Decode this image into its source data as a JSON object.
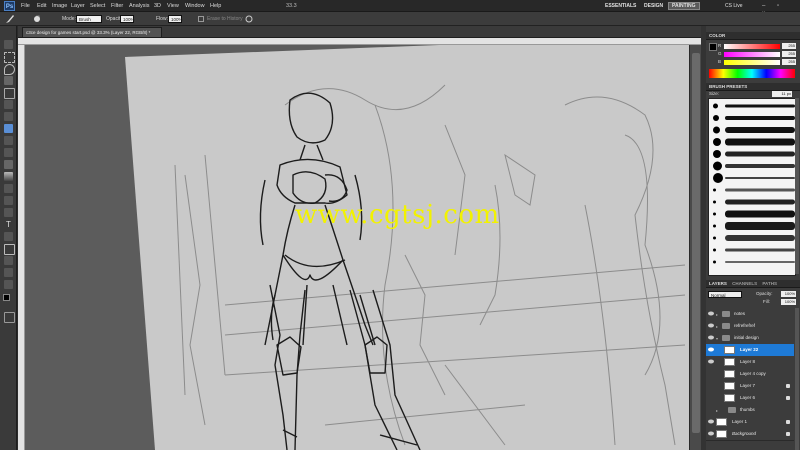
{
  "app": {
    "logo": "Ps"
  },
  "menu": [
    "File",
    "Edit",
    "Image",
    "Layer",
    "Select",
    "Filter",
    "Analysis",
    "3D",
    "View",
    "Window",
    "Help"
  ],
  "menu_right": {
    "zoom": "33.3",
    "workspaces": [
      "ESSENTIALS",
      "DESIGN",
      "PAINTING"
    ],
    "active_workspace": "PAINTING",
    "cslive": "CS Live"
  },
  "options": {
    "mode_label": "Mode:",
    "mode_value": "Brush",
    "opacity_label": "Opacity:",
    "opacity_value": "100%",
    "flow_label": "Flow:",
    "flow_value": "100%",
    "erase_history": "Erase to History",
    "brush_size": "11"
  },
  "document": {
    "tab": "c3ce design for games start.psd @ 33.3% (Layer 22, RGB/8) *"
  },
  "watermark": "www.cgtsj.com",
  "color_panel": {
    "title": "COLOR",
    "channels": [
      {
        "label": "R",
        "value": "255"
      },
      {
        "label": "G",
        "value": "255"
      },
      {
        "label": "B",
        "value": "255"
      }
    ]
  },
  "brush_panel": {
    "title": "BRUSH PRESETS",
    "size_label": "Size:",
    "size_value": "11 px"
  },
  "layers_panel": {
    "tabs": [
      "LAYERS",
      "CHANNELS",
      "PATHS"
    ],
    "blend_mode": "Normal",
    "opacity_label": "Opacity:",
    "opacity_value": "100%",
    "fill_label": "Fill:",
    "fill_value": "100%",
    "layers": [
      {
        "name": "notes",
        "type": "group"
      },
      {
        "name": "refrefrefref",
        "type": "group"
      },
      {
        "name": "initial design",
        "type": "group"
      },
      {
        "name": "Layer 22",
        "type": "layer",
        "selected": true
      },
      {
        "name": "Layer 8",
        "type": "layer"
      },
      {
        "name": "Layer 4 copy",
        "type": "layer"
      },
      {
        "name": "Layer 7",
        "type": "layer",
        "locked": true
      },
      {
        "name": "Layer 6",
        "type": "layer",
        "locked": true
      },
      {
        "name": "thumbs",
        "type": "group"
      },
      {
        "name": "Layer 1",
        "type": "layer",
        "locked": true
      },
      {
        "name": "Background",
        "type": "layer",
        "locked": true
      }
    ]
  },
  "icons": {
    "eye": "eye-icon",
    "folder": "folder-icon",
    "lock": "lock-icon"
  }
}
